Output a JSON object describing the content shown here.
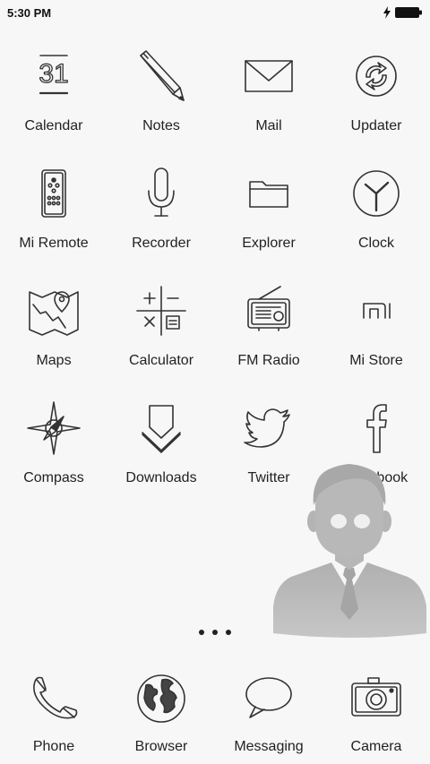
{
  "status_bar": {
    "time": "5:30 PM"
  },
  "apps": [
    {
      "label": "Calendar",
      "icon": "calendar-icon",
      "date_num": "31"
    },
    {
      "label": "Notes",
      "icon": "pencil-icon"
    },
    {
      "label": "Mail",
      "icon": "envelope-icon"
    },
    {
      "label": "Updater",
      "icon": "refresh-icon"
    },
    {
      "label": "Mi Remote",
      "icon": "remote-icon"
    },
    {
      "label": "Recorder",
      "icon": "microphone-icon"
    },
    {
      "label": "Explorer",
      "icon": "folder-icon"
    },
    {
      "label": "Clock",
      "icon": "clock-icon"
    },
    {
      "label": "Maps",
      "icon": "map-icon"
    },
    {
      "label": "Calculator",
      "icon": "calculator-icon"
    },
    {
      "label": "FM Radio",
      "icon": "radio-icon"
    },
    {
      "label": "Mi Store",
      "icon": "mi-logo-icon"
    },
    {
      "label": "Compass",
      "icon": "compass-icon"
    },
    {
      "label": "Downloads",
      "icon": "download-icon"
    },
    {
      "label": "Twitter",
      "icon": "twitter-bird-icon"
    },
    {
      "label": "Facebook",
      "icon": "facebook-f-icon"
    }
  ],
  "dock": [
    {
      "label": "Phone",
      "icon": "phone-handset-icon"
    },
    {
      "label": "Browser",
      "icon": "globe-icon"
    },
    {
      "label": "Messaging",
      "icon": "speech-bubble-icon"
    },
    {
      "label": "Camera",
      "icon": "camera-icon"
    }
  ],
  "page_indicator": {
    "pages": 3,
    "current": 2
  },
  "colors": {
    "background": "#f7f7f7",
    "text": "#222222",
    "line_icon": "#333333",
    "avatar": "#b3b3b3"
  }
}
